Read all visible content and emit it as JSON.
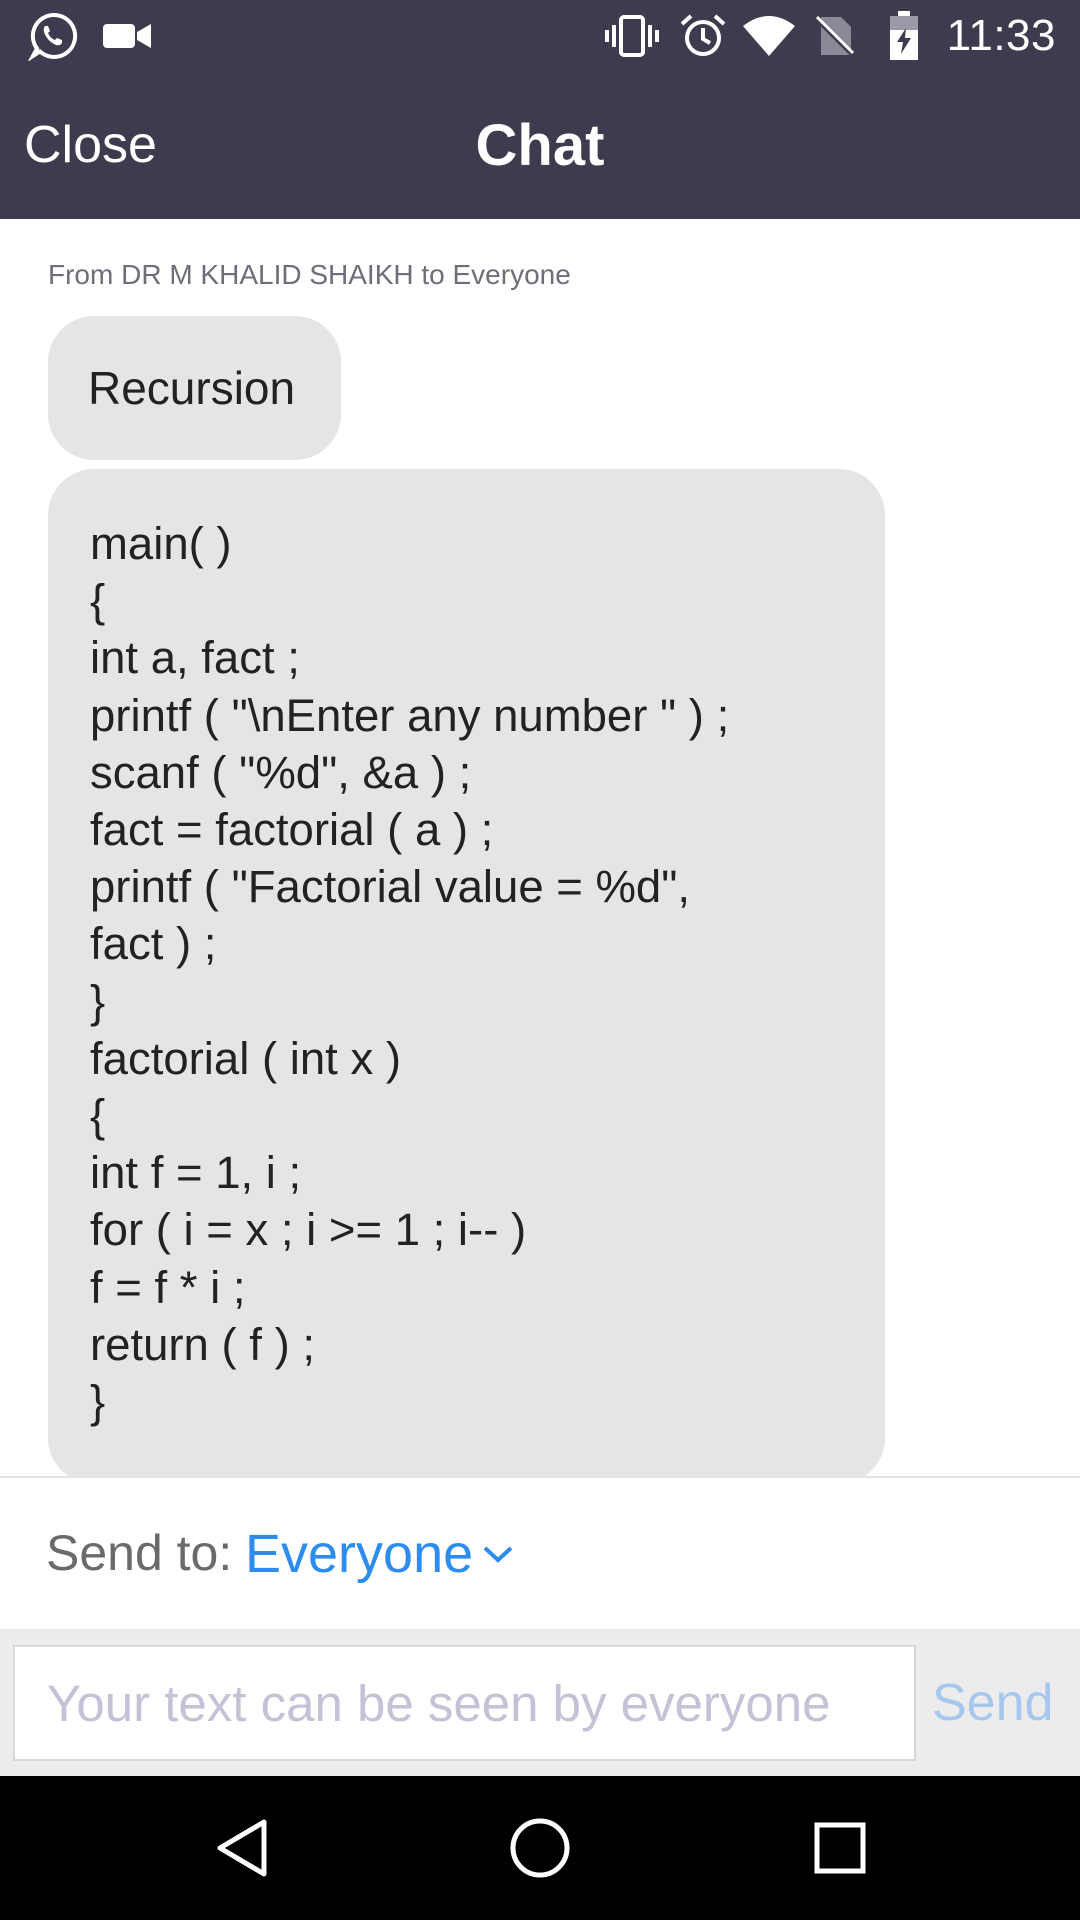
{
  "status_bar": {
    "time": "11:33",
    "left_icons": [
      "whatsapp-icon",
      "video-camera-icon"
    ],
    "right_icons": [
      "vibrate-icon",
      "alarm-icon",
      "wifi-icon",
      "no-sim-icon",
      "battery-charging-icon"
    ]
  },
  "header": {
    "close_label": "Close",
    "title": "Chat"
  },
  "chat": {
    "sender_line": "From DR M KHALID SHAIKH to Everyone",
    "messages": [
      {
        "text": "Recursion"
      },
      {
        "text": "main( )\n{\nint a, fact ;\nprintf ( \"\\nEnter any number \" ) ;\nscanf ( \"%d\", &a ) ;\nfact = factorial ( a ) ;\nprintf ( \"Factorial value = %d\",\nfact ) ;\n}\nfactorial ( int x )\n{\nint f = 1, i ;\nfor ( i = x ; i >= 1 ; i-- )\nf = f * i ;\nreturn ( f ) ;\n}"
      }
    ]
  },
  "send_to": {
    "label": "Send to:",
    "value": "Everyone"
  },
  "composer": {
    "placeholder": "Your text can be seen by everyone",
    "value": "",
    "send_label": "Send"
  },
  "nav": {
    "buttons": [
      "back-icon",
      "home-icon",
      "recents-icon"
    ]
  },
  "colors": {
    "header_bg": "#3c3c4e",
    "bubble_bg": "#e5e5e5",
    "accent_blue": "#2d8cf0",
    "send_disabled": "#a6c8ef",
    "placeholder": "#c4c2d6"
  }
}
